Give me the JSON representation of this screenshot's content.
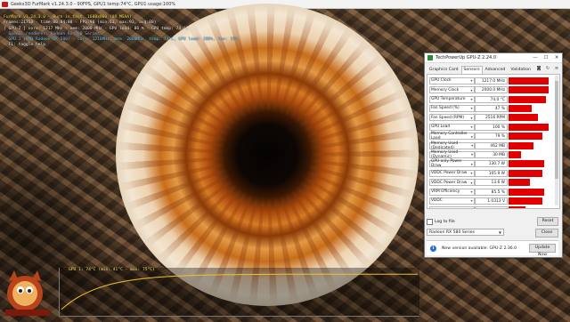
{
  "furmark": {
    "title": "Geeks3D FurMark v1.24.3.0 - 90FPS, GPU1 temp:74°C, GPU1 usage:100%",
    "overlay": {
      "line1": "FurMark v1.24.3.0 - Burn-in test, 1600x900 (0X MSAA)",
      "line2": "Frames:21758 - time:00:04:08 - FPS:90 (min:63, max:93, avg:88)",
      "line3": "[ GPU-Z ] core: 1217 MHz - mem: 2000 MHz - GPU load: 86 % - GPU temp: 74 °C",
      "line4": "- OpenGL renderer: Radeon RX 580 Series",
      "line5": "- GPU 1 (AMD Radeon RX 580) - core: 1216MHz, mem: 2000MHz, temp: 74°C, GPU load: 100%, fan: 19%",
      "line6": "- F1: toggle help"
    },
    "graph_label": "GPU 1: 74°C (min: 41°C - max: 75°C)",
    "temperature_graph": {
      "min": 41,
      "max": 75,
      "current": 74
    },
    "colors": {
      "overlay_title": "#f5e24a",
      "overlay_gpu": "#5fd3ff",
      "graph_line": "#f0c030"
    }
  },
  "gpuz": {
    "title": "TechPowerUp GPU-Z 2.24.0",
    "window_buttons": {
      "minimize": "—",
      "maximize": "☐",
      "close": "✕"
    },
    "tabs": [
      {
        "label": "Graphics Card",
        "active": false
      },
      {
        "label": "Sensors",
        "active": true
      },
      {
        "label": "Advanced",
        "active": false
      },
      {
        "label": "Validation",
        "active": false
      }
    ],
    "tool_icons": [
      "camera-icon",
      "refresh-icon",
      "menu-icon"
    ],
    "sensors": [
      {
        "name": "GPU Clock",
        "value": "1217.0 MHz",
        "level": 0.95
      },
      {
        "name": "Memory Clock",
        "value": "2000.0 MHz",
        "level": 0.95
      },
      {
        "name": "GPU Temperature",
        "value": "74.0 °C",
        "level": 0.9
      },
      {
        "name": "Fan Speed (%)",
        "value": "47 %",
        "level": 0.55
      },
      {
        "name": "Fan Speed (RPM)",
        "value": "2516 RPM",
        "level": 0.7
      },
      {
        "name": "GPU Load",
        "value": "100 %",
        "level": 0.95
      },
      {
        "name": "Memory Controller Load",
        "value": "79 %",
        "level": 0.8
      },
      {
        "name": "Memory Used (Dedicated)",
        "value": "462 MB",
        "level": 0.6
      },
      {
        "name": "Memory Used (Dynamic)",
        "value": "30 MB",
        "level": 0.3
      },
      {
        "name": "GPU only Power Draw",
        "value": "130.7 W",
        "level": 0.85
      },
      {
        "name": "VDDC Power Draw",
        "value": "105.9 W",
        "level": 0.8
      },
      {
        "name": "VDDC Power Draw",
        "value": "13.6 W",
        "level": 0.5
      },
      {
        "name": "VRM Efficiency",
        "value": "85.5 %",
        "level": 0.85
      },
      {
        "name": "VDDC",
        "value": "1.0313 V",
        "level": 0.8
      },
      {
        "name": "",
        "value": "",
        "level": 0.4
      }
    ],
    "log_label": "Log to file",
    "reset_label": "Reset",
    "card_select": "Radeon RX 580 Series",
    "close_label": "Close",
    "update_text": "New version available: GPU-Z 2.36.0",
    "update_button": "Update Now",
    "colors": {
      "sensor_graph": "#e00000"
    }
  }
}
